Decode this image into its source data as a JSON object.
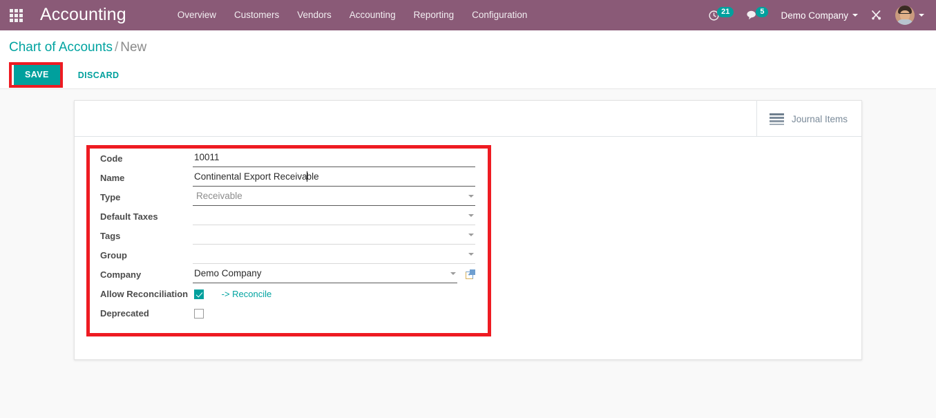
{
  "navbar": {
    "apps_icon": "apps-grid-icon",
    "brand": "Accounting",
    "menu": [
      {
        "label": "Overview"
      },
      {
        "label": "Customers"
      },
      {
        "label": "Vendors"
      },
      {
        "label": "Accounting"
      },
      {
        "label": "Reporting"
      },
      {
        "label": "Configuration"
      }
    ],
    "systray": {
      "activity_icon": "clock-activity-icon",
      "activity_count": "21",
      "messages_icon": "chat-bubble-icon",
      "messages_count": "5",
      "company": "Demo Company",
      "debug_icon": "wrench-screwdriver-icon",
      "avatar_icon": "user-avatar"
    },
    "colors": {
      "background": "#8a5a77",
      "badge": "#00a09d"
    }
  },
  "control_panel": {
    "breadcrumb": {
      "parent": "Chart of Accounts",
      "separator": "/",
      "current": "New"
    },
    "save_label": "SAVE",
    "discard_label": "DISCARD",
    "colors": {
      "save_bg": "#00a09d",
      "highlight": "#ee1b22",
      "link": "#00a3a0"
    }
  },
  "sheet": {
    "stat_button": {
      "icon": "list-bars-icon",
      "label": "Journal Items"
    },
    "fields": [
      {
        "label": "Code",
        "kind": "text",
        "value": "10011",
        "placeholder": "",
        "underline": "dark"
      },
      {
        "label": "Name",
        "kind": "text-cursor",
        "value_before": "Continental Export Receiva",
        "value_after": "ble",
        "value": "Continental Export Receivable",
        "placeholder": "",
        "underline": "dark"
      },
      {
        "label": "Type",
        "kind": "select",
        "value": "Receivable",
        "underline": "dark"
      },
      {
        "label": "Default Taxes",
        "kind": "select",
        "value": "",
        "underline": "light"
      },
      {
        "label": "Tags",
        "kind": "select",
        "value": "",
        "underline": "light"
      },
      {
        "label": "Group",
        "kind": "select",
        "value": "",
        "underline": "light"
      },
      {
        "label": "Company",
        "kind": "select-link",
        "value": "Demo Company",
        "underline": "dark",
        "link_icon": "external-link-icon"
      },
      {
        "label": "Allow Reconciliation",
        "kind": "checkbox",
        "checked": true,
        "action_label": "-> Reconcile"
      },
      {
        "label": "Deprecated",
        "kind": "checkbox",
        "checked": false,
        "action_label": ""
      }
    ]
  }
}
